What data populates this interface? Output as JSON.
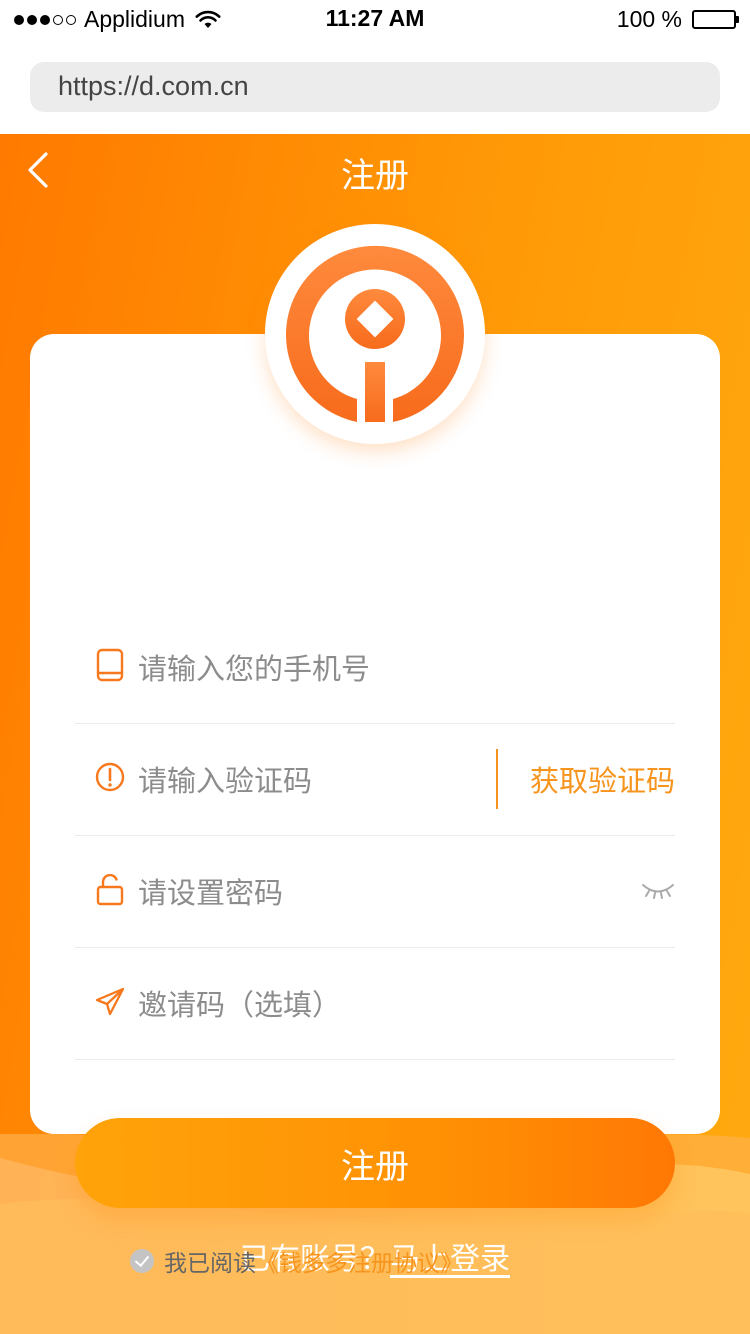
{
  "status_bar": {
    "carrier": "Applidium",
    "time": "11:27 AM",
    "battery": "100 %",
    "signal_dots": [
      true,
      true,
      true,
      false,
      false
    ]
  },
  "browser": {
    "url": "https://d.com.cn"
  },
  "nav": {
    "title": "注册"
  },
  "form": {
    "phone_placeholder": "请输入您的手机号",
    "code_placeholder": "请输入验证码",
    "get_code_label": "获取验证码",
    "password_placeholder": "请设置密码",
    "invite_placeholder": "邀请码（选填）",
    "submit_label": "注册"
  },
  "agreement": {
    "text": "我已阅读",
    "link": "《钱多多注册协议》"
  },
  "footer": {
    "prompt": "已有账号？",
    "login_link": "马上登录"
  },
  "colors": {
    "brand_orange": "#ff8a00",
    "accent": "#f7941d",
    "placeholder": "#8c8c8c"
  }
}
